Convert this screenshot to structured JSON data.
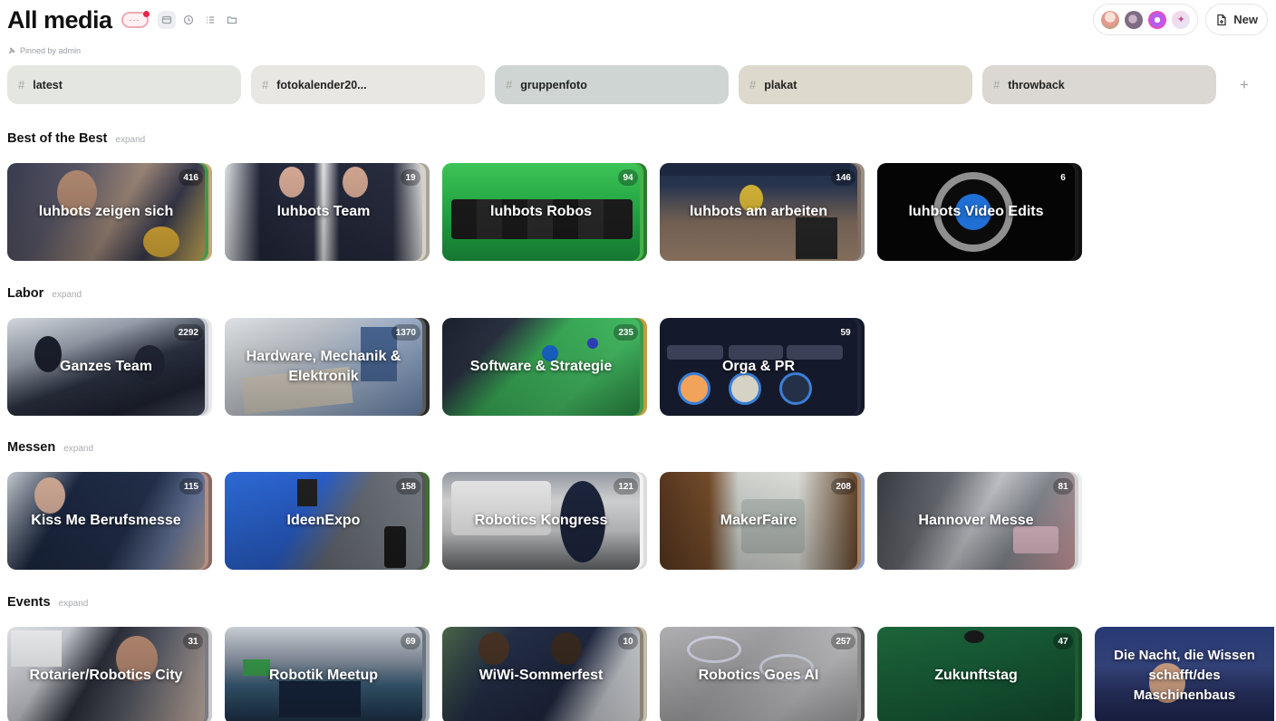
{
  "header": {
    "title": "All media",
    "badge_text": "···",
    "new_label": "New"
  },
  "pinned": {
    "text": "Pinned by admin"
  },
  "tags": [
    {
      "label": "latest",
      "color": "#e4e6e2"
    },
    {
      "label": "fotokalender20...",
      "color": "#e9e7e3"
    },
    {
      "label": "gruppenfoto",
      "color": "#cfd5d2"
    },
    {
      "label": "plakat",
      "color": "#ddd9cc"
    },
    {
      "label": "throwback",
      "color": "#dbd8d3"
    }
  ],
  "tag_add": "+",
  "sections": [
    {
      "title": "Best of the Best",
      "expand": "expand",
      "cards": [
        {
          "name": "luhbots zeigen sich",
          "count": "416"
        },
        {
          "name": "luhbots Team",
          "count": "19"
        },
        {
          "name": "luhbots Robos",
          "count": "94"
        },
        {
          "name": "luhbots am arbeiten",
          "count": "146"
        },
        {
          "name": "luhbots Video Edits",
          "count": "6"
        }
      ]
    },
    {
      "title": "Labor",
      "expand": "expand",
      "cards": [
        {
          "name": "Ganzes Team",
          "count": "2292"
        },
        {
          "name": "Hardware, Mechanik & Elektronik",
          "count": "1370"
        },
        {
          "name": "Software & Strategie",
          "count": "235"
        },
        {
          "name": "Orga & PR",
          "count": "59"
        }
      ]
    },
    {
      "title": "Messen",
      "expand": "expand",
      "cards": [
        {
          "name": "Kiss Me Berufsmesse",
          "count": "115"
        },
        {
          "name": "IdeenExpo",
          "count": "158"
        },
        {
          "name": "Robotics Kongress",
          "count": "121"
        },
        {
          "name": "MakerFaire",
          "count": "208"
        },
        {
          "name": "Hannover Messe",
          "count": "81"
        }
      ]
    },
    {
      "title": "Events",
      "expand": "expand",
      "cards": [
        {
          "name": "Rotarier/Robotics City",
          "count": "31"
        },
        {
          "name": "Robotik Meetup",
          "count": "69"
        },
        {
          "name": "WiWi-Sommerfest",
          "count": "10"
        },
        {
          "name": "Robotics Goes AI",
          "count": "257"
        },
        {
          "name": "Zukunftstag",
          "count": "47"
        },
        {
          "name": "Die Nacht, die Wissen schafft/des Maschinenbaus",
          "count": ""
        }
      ]
    }
  ]
}
